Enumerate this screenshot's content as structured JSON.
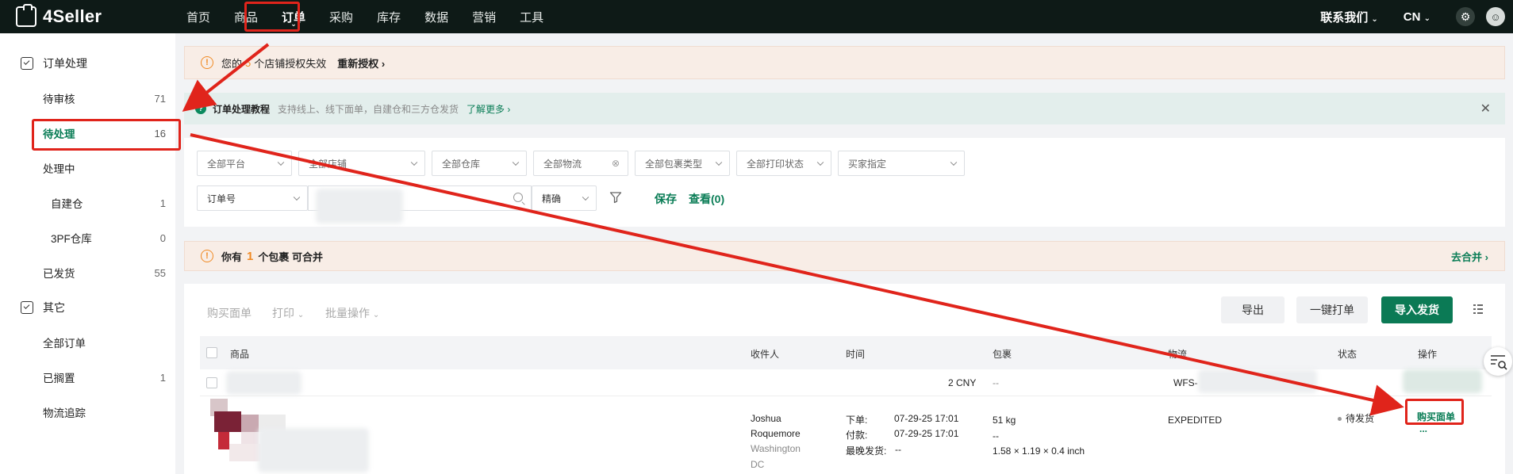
{
  "header": {
    "logo_text": "4Seller",
    "nav": [
      "首页",
      "商品",
      "订单",
      "采购",
      "库存",
      "数据",
      "营销",
      "工具"
    ],
    "active_nav": "订单",
    "contact": "联系我们",
    "lang": "CN"
  },
  "sidebar": {
    "group_orders": "订单处理",
    "items": [
      {
        "label": "待审核",
        "count": "71"
      },
      {
        "label": "待处理",
        "count": "16"
      },
      {
        "label": "处理中",
        "count": ""
      },
      {
        "label": "自建仓",
        "count": "1"
      },
      {
        "label": "3PF仓库",
        "count": "0"
      },
      {
        "label": "已发货",
        "count": "55"
      }
    ],
    "group_other": "其它",
    "other_items": [
      {
        "label": "全部订单",
        "count": ""
      },
      {
        "label": "已搁置",
        "count": "1"
      },
      {
        "label": "物流追踪",
        "count": ""
      }
    ]
  },
  "auth_alert": {
    "prefix": "您的",
    "count": "5",
    "suffix": "个店铺授权失效",
    "link": "重新授权"
  },
  "tutorial": {
    "title": "订单处理教程",
    "desc": "支持线上、线下面单，自建仓和三方仓发货",
    "more": "了解更多"
  },
  "filters": {
    "row1": [
      "全部平台",
      "全部店铺",
      "全部仓库",
      "全部物流",
      "全部包裹类型",
      "全部打印状态",
      "买家指定"
    ],
    "search_field": "订单号",
    "match_mode": "精确",
    "save": "保存",
    "view": "查看(0)"
  },
  "merge_bar": {
    "prefix": "你有",
    "count": "1",
    "suffix": "个包裹 可合并",
    "action": "去合并"
  },
  "toolbar": {
    "buy_label": "购买面单",
    "print": "打印",
    "batch": "批量操作",
    "export": "导出",
    "one_click_print": "一键打单",
    "import_ship": "导入发货"
  },
  "table": {
    "columns": [
      "商品",
      "收件人",
      "时间",
      "包裹",
      "物流",
      "状态",
      "操作"
    ],
    "subrow": {
      "amount": "2 CNY",
      "package": "--",
      "logistics_prefix": "WFS-"
    },
    "row": {
      "recipient_name_1": "Joshua",
      "recipient_name_2": "Roquemore",
      "recipient_city": "Washington",
      "recipient_state": "DC",
      "order_label": "下单:",
      "order_time": "07-29-25 17:01",
      "pay_label": "付款:",
      "pay_time": "07-29-25 17:01",
      "latest_label": "最晚发货:",
      "latest_value": "--",
      "weight": "51 kg",
      "package_dash": "--",
      "dimensions": "1.58 × 1.19 × 0.4 inch",
      "logistics": "EXPEDITED",
      "status": "待发货",
      "action": "购买面单",
      "more": "..."
    }
  },
  "colors": {
    "accent": "#0a7d56",
    "warning": "#f08a24",
    "highlight": "#e0241b",
    "topbar": "#0e1a17"
  }
}
